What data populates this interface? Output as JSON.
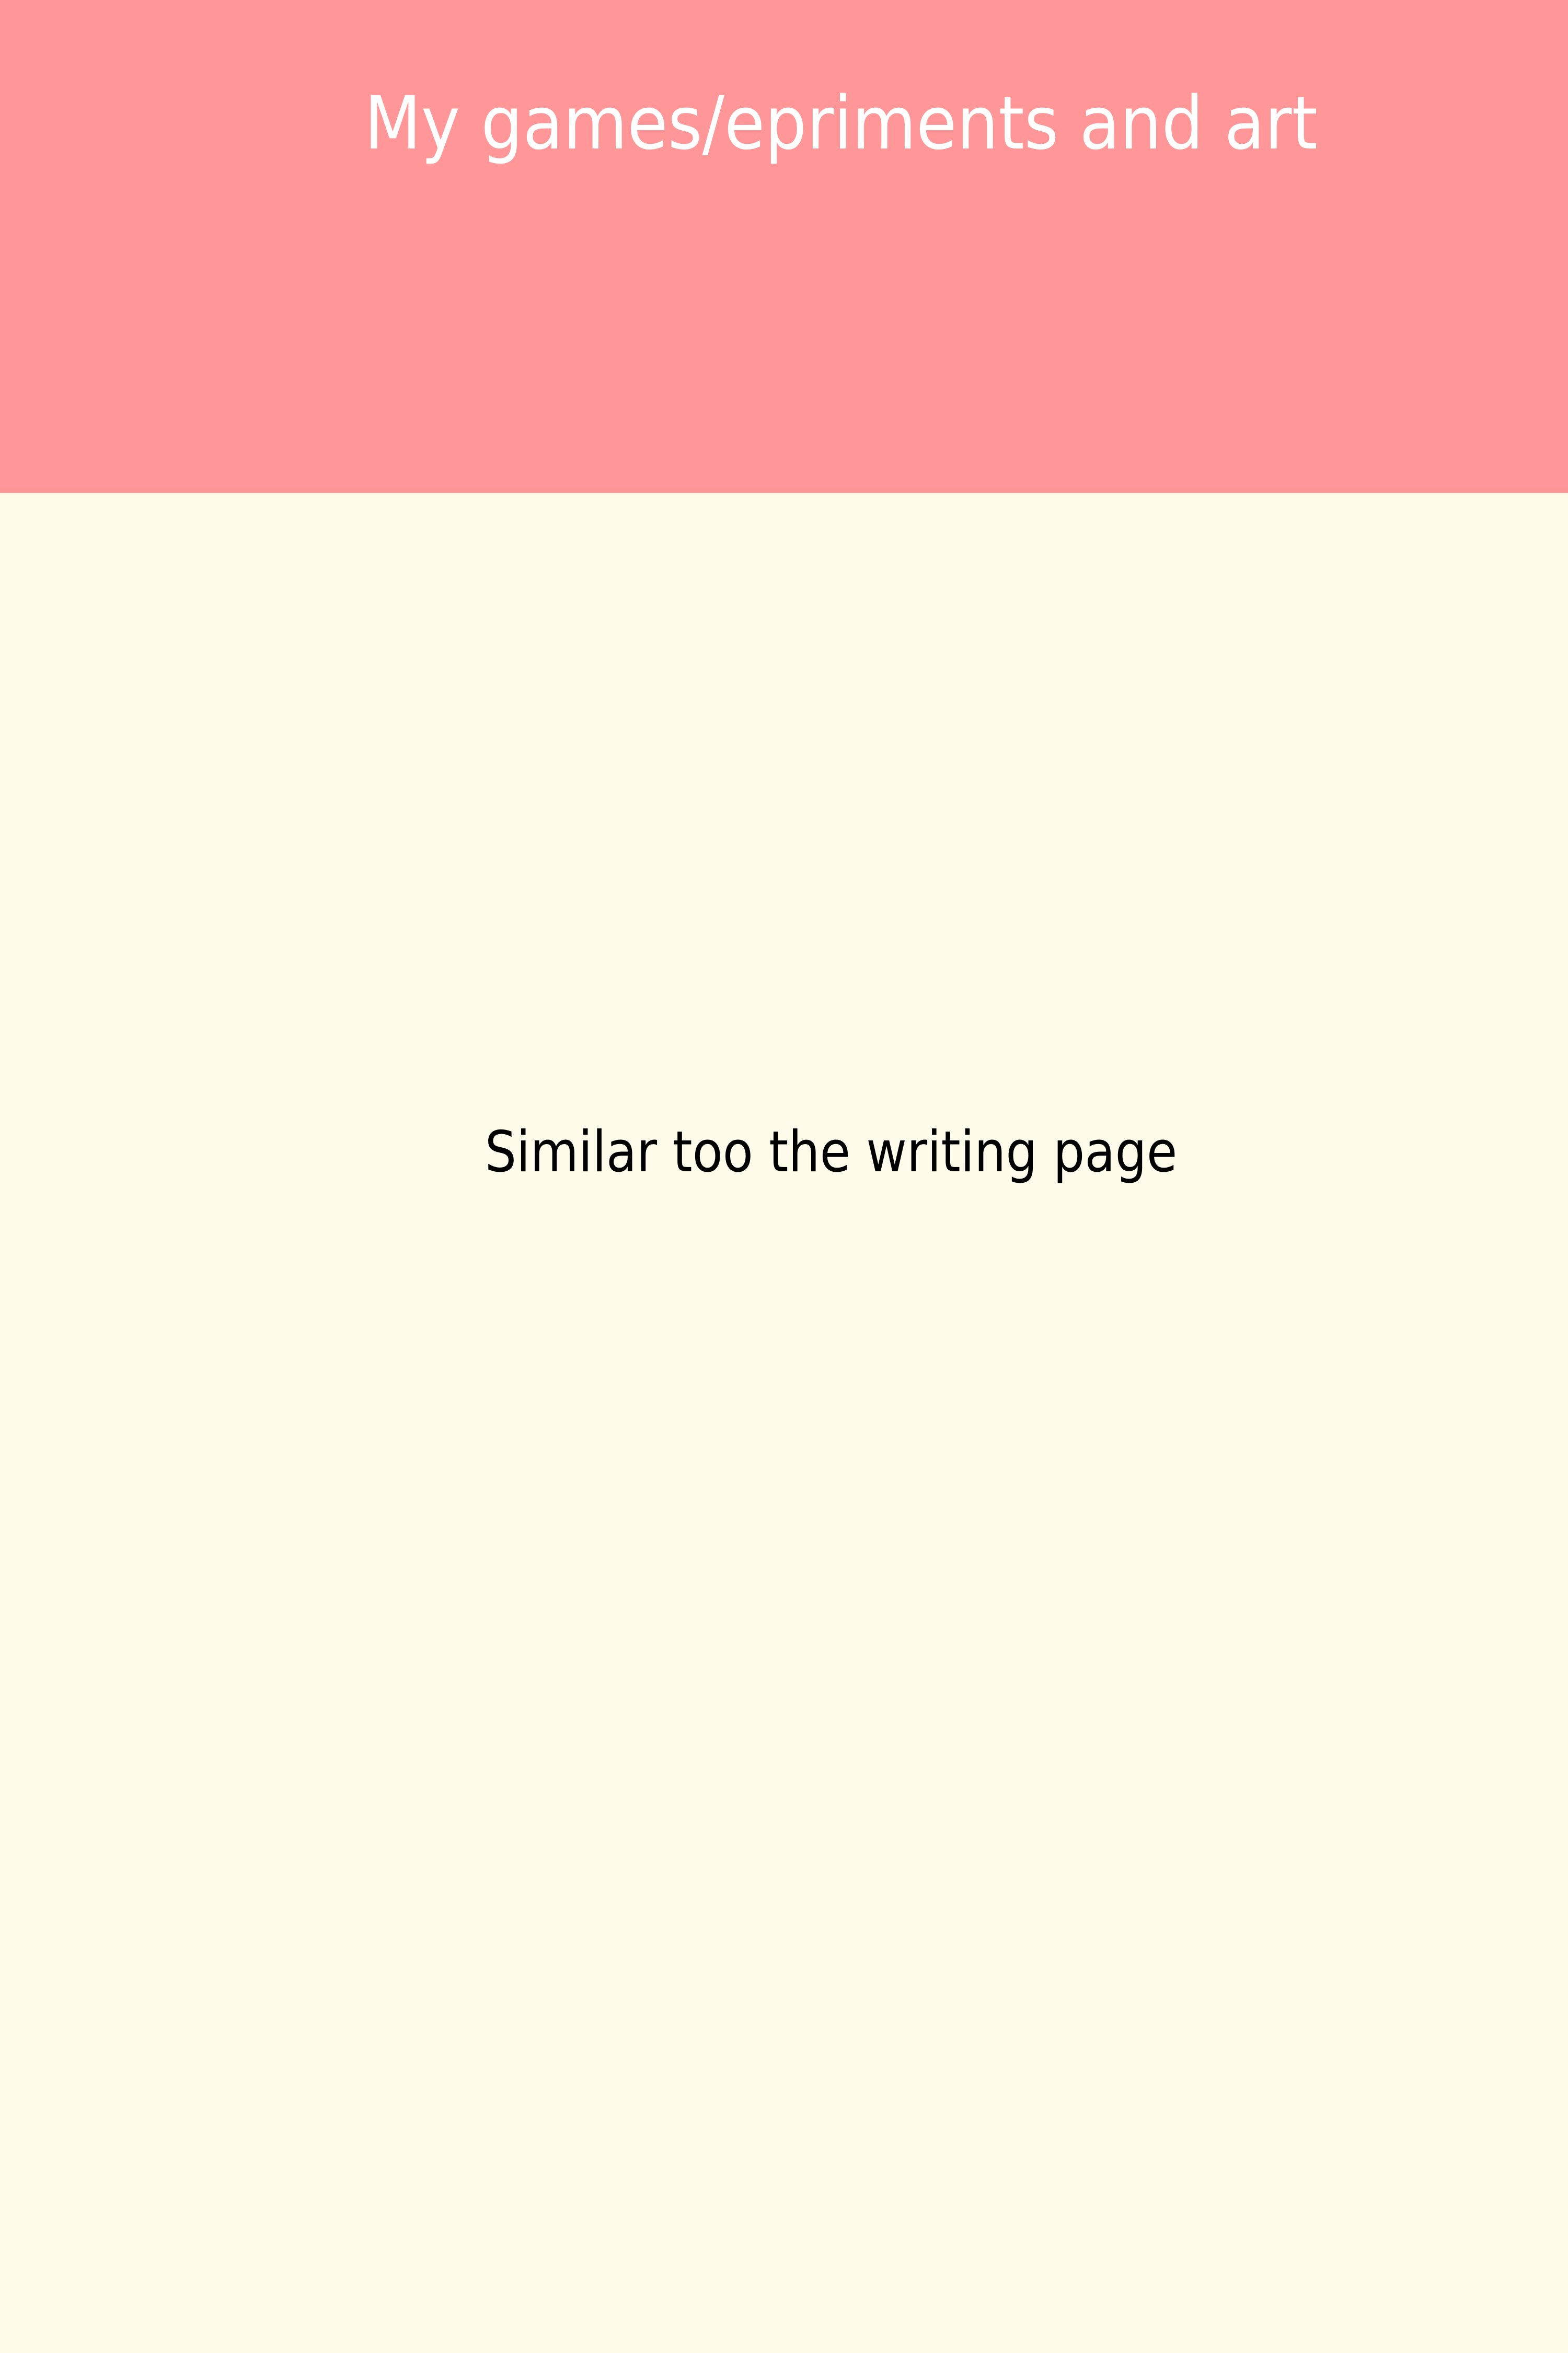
{
  "header": {
    "title": "My games/epriments and art",
    "background_color": "#ff9798",
    "text_color": "#ffffff"
  },
  "main": {
    "text": "Similar too the writing page",
    "background_color": "#fffbea",
    "text_color": "#000000"
  }
}
